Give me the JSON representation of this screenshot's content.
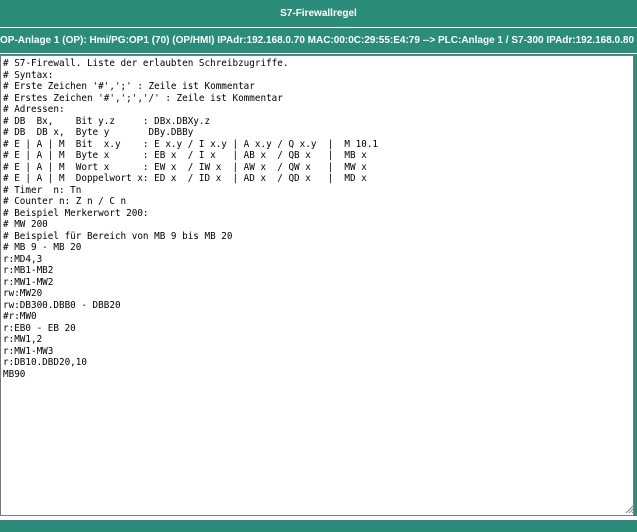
{
  "window": {
    "title": "S7-Firewallregel"
  },
  "connection": {
    "text": "OP-Anlage 1 (OP): Hmi/PG:OP1 (70) (OP/HMI) IPAdr:192.168.0.70 MAC:00:0C:29:55:E4:79 --> PLC:Anlage 1 / S7-300 IPAdr:192.168.0.80"
  },
  "editor": {
    "content": "# S7-Firewall. Liste der erlaubten Schreibzugriffe.\n# Syntax:\n# Erste Zeichen '#',';' : Zeile ist Kommentar\n# Erstes Zeichen '#',';','/' : Zeile ist Kommentar\n# Adressen:\n# DB  Bx,    Bit y.z     : DBx.DBXy.z\n# DB  DB x,  Byte y       DBy.DBBy\n# E | A | M  Bit  x.y    : E x.y / I x.y | A x.y / Q x.y  |  M 10.1\n# E | A | M  Byte x      : EB x  / I x   | AB x  / QB x   |  MB x\n# E | A | M  Wort x      : EW x  / IW x  | AW x  / QW x   |  MW x\n# E | A | M  Doppelwort x: ED x  / ID x  | AD x  / QD x   |  MD x\n# Timer  n: Tn\n# Counter n: Z n / C n\n# Beispiel Merkerwort 200:\n# MW 200\n# Beispiel für Bereich von MB 9 bis MB 20\n# MB 9 - MB 20\nr:MD4,3\nr:MB1-MB2\nr:MW1-MW2\nrw:MW20\nrw:DB300.DBB0 - DBB20\n#r:MW0\nr:EB0 - EB 20\nr:MW1,2\nr:MW1-MW3\nr:DB10.DBD20,10\nMB90"
  },
  "colors": {
    "bar": "#2c8c7a",
    "text_on_bar": "#ffffff"
  },
  "icons": {
    "resize": "resize-grip-icon"
  }
}
